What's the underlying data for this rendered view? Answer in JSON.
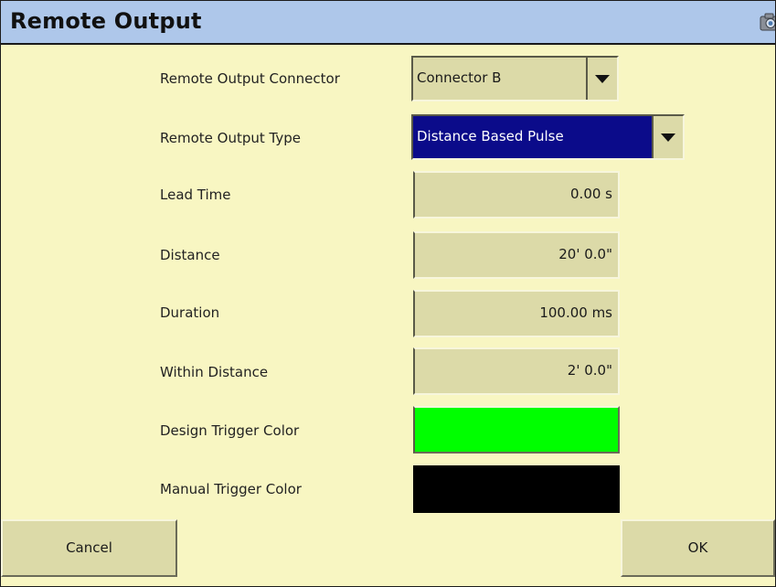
{
  "window": {
    "title": "Remote Output",
    "title_icon": "camera-icon"
  },
  "form": {
    "connector": {
      "label": "Remote Output Connector",
      "value": "Connector B"
    },
    "output_type": {
      "label": "Remote Output Type",
      "value": "Distance Based Pulse"
    },
    "lead_time": {
      "label": "Lead Time",
      "value": "0.00 s"
    },
    "distance": {
      "label": "Distance",
      "value": "20' 0.0\""
    },
    "duration": {
      "label": "Duration",
      "value": "100.00 ms"
    },
    "within_distance": {
      "label": "Within Distance",
      "value": "2' 0.0\""
    },
    "design_trigger_color": {
      "label": "Design Trigger Color",
      "color": "#00ff00"
    },
    "manual_trigger_color": {
      "label": "Manual Trigger Color",
      "color": "#000000"
    }
  },
  "buttons": {
    "cancel": "Cancel",
    "ok": "OK"
  },
  "theme": {
    "panel_bg": "#f8f6c2",
    "titlebar_bg": "#aec7ea",
    "control_bg": "#dcdaa8",
    "selected_bg": "#0b0b8a"
  }
}
